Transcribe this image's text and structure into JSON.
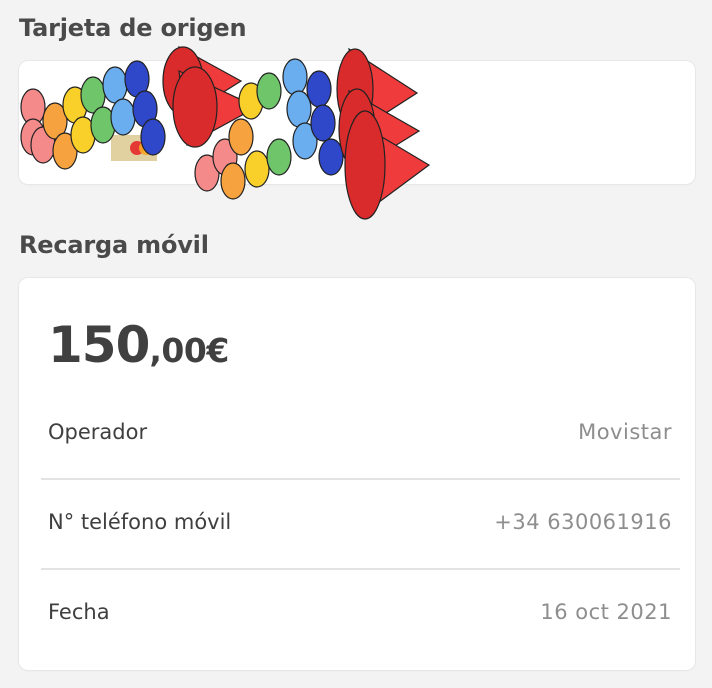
{
  "origin_section": {
    "title": "Tarjeta de origen",
    "card_brand_icon": "mastercard-icon"
  },
  "recharge_section": {
    "title": "Recarga móvil",
    "amount_integer": "150",
    "amount_decimal": ",00€",
    "rows": [
      {
        "label": "Operador",
        "value": "Movistar"
      },
      {
        "label": "N° teléfono móvil",
        "value": "+34 630061916"
      },
      {
        "label": "Fecha",
        "value": "16 oct 2021"
      }
    ]
  },
  "colors": {
    "background": "#f3f3f4",
    "card": "#ffffff",
    "divider": "#e3e3e6",
    "value_text": "#8e8e8e"
  }
}
